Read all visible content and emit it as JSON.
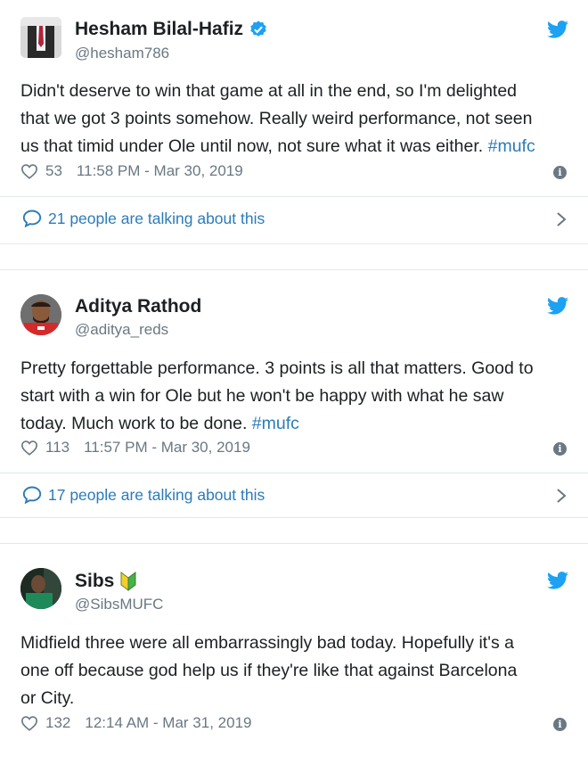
{
  "colors": {
    "link": "#2b7bb9",
    "verified": "#1da1f2",
    "muted": "#697882",
    "divider": "#e1e8ed"
  },
  "tweets": [
    {
      "name": "Hesham Bilal-Hafiz",
      "handle": "@hesham786",
      "verified": true,
      "text_lines": [
        "Didn't deserve to win that game at all in the end, so I'm delighted",
        "that we got 3 points somehow. Really weird performance, not seen"
      ],
      "text_last": "us that timid under Ole until now, not sure what it was either.",
      "hashtag": "#mufc",
      "likes": "53",
      "timestamp": "11:58 PM - Mar 30, 2019",
      "talking": "21 people are talking about this"
    },
    {
      "name": "Aditya Rathod",
      "handle": "@aditya_reds",
      "verified": false,
      "text_lines": [
        "Pretty forgettable performance. 3 points is all that matters. Good to",
        "start with a win for Ole but he won't be happy with what he saw"
      ],
      "text_last": "today. Much work to be done.",
      "hashtag": "#mufc",
      "likes": "113",
      "timestamp": "11:57 PM - Mar 30, 2019",
      "talking": "17 people are talking about this"
    },
    {
      "name": "Sibs",
      "handle": "@SibsMUFC",
      "verified": false,
      "text_lines": [
        "Midfield three were all embarrassingly bad today. Hopefully it's a",
        "one off because god help us if they're like that against Barcelona"
      ],
      "text_last": "or City.",
      "hashtag": "",
      "likes": "132",
      "timestamp": "12:14 AM - Mar 31, 2019"
    }
  ],
  "icons": {
    "twitter": "twitter-bird-icon",
    "verified": "verified-badge-icon",
    "beginner": "beginner-leaf-emoji",
    "heart": "heart-icon",
    "info": "info-icon",
    "bubble": "speech-bubble-icon",
    "chevron": "chevron-right-icon"
  }
}
